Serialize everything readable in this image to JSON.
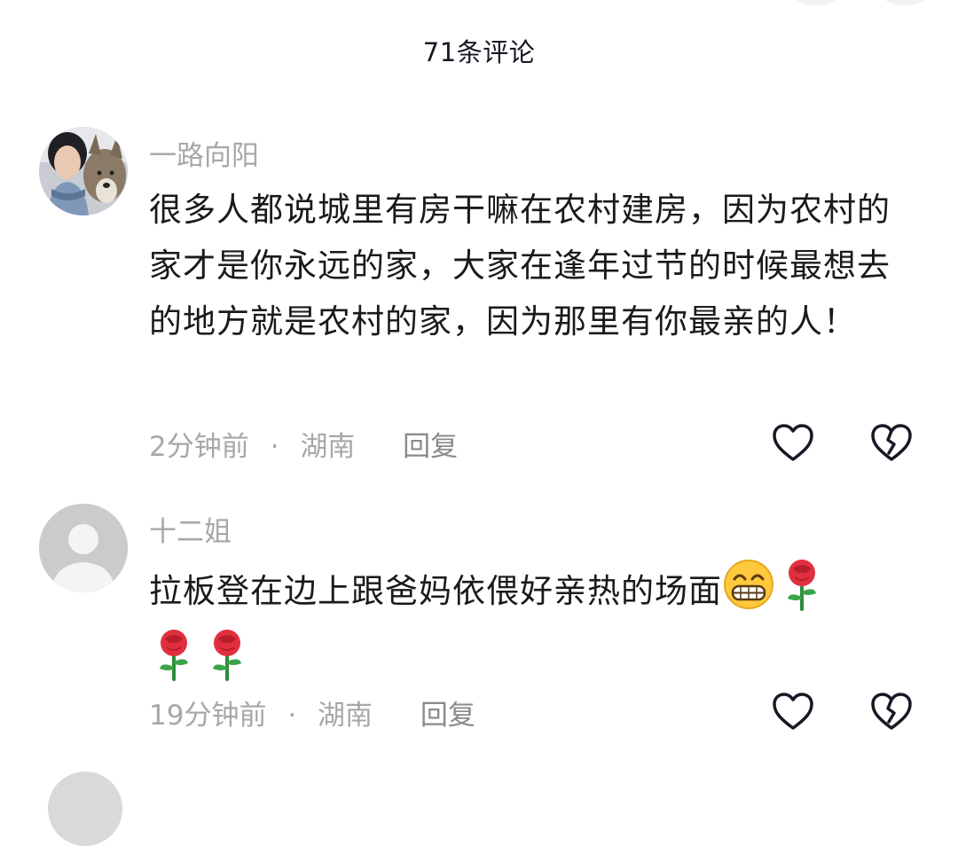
{
  "header": {
    "title": "71条评论"
  },
  "comments": [
    {
      "username": "一路向阳",
      "text": "很多人都说城里有房干嘛在农村建房，因为农村的家才是你永远的家，大家在逢年过节的时候最想去的地方就是农村的家，因为那里有你最亲的人！",
      "time": "2分钟前",
      "separator": "·",
      "location": "湖南",
      "reply_label": "回复"
    },
    {
      "username": "十二姐",
      "text": "拉板登在边上跟爸妈依偎好亲热的场面",
      "emojis": [
        "grin-emoji",
        "rose-emoji",
        "rose-emoji",
        "rose-emoji"
      ],
      "time": "19分钟前",
      "separator": "·",
      "location": "湖南",
      "reply_label": "回复"
    }
  ],
  "icons": {
    "like": "heart-outline-icon",
    "dislike": "broken-heart-outline-icon"
  },
  "colors": {
    "meta_gray": "#a7a7ab",
    "text_dark": "#161823",
    "rose_red": "#e0303f",
    "emoji_yellow": "#ffc83d"
  }
}
